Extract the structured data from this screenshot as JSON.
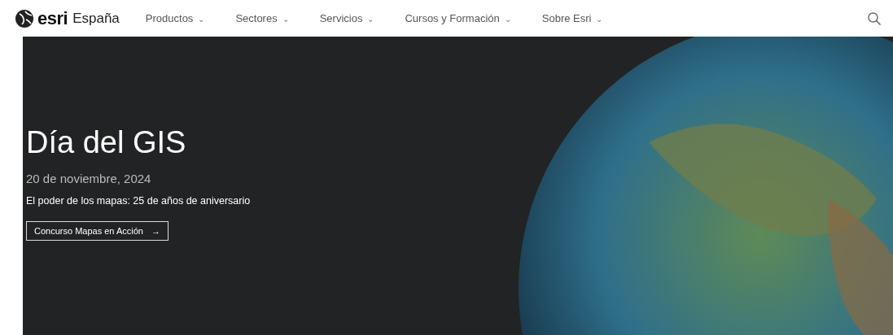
{
  "header": {
    "logo": {
      "brand": "esri",
      "region": "España"
    },
    "nav": [
      {
        "label": "Productos",
        "caret": "⌄"
      },
      {
        "label": "Sectores",
        "caret": "⌄"
      },
      {
        "label": "Servicios",
        "caret": "⌄"
      },
      {
        "label": "Cursos y Formación",
        "caret": "⌄"
      },
      {
        "label": "Sobre Esri",
        "caret": "⌄"
      }
    ]
  },
  "hero": {
    "title": "Día del GIS",
    "date": "20 de noviembre, 2024",
    "subtitle": "El poder de los mapas: 25 de años de aniversario",
    "button": {
      "label": "Concurso Mapas en Acción",
      "arrow": "→"
    }
  }
}
